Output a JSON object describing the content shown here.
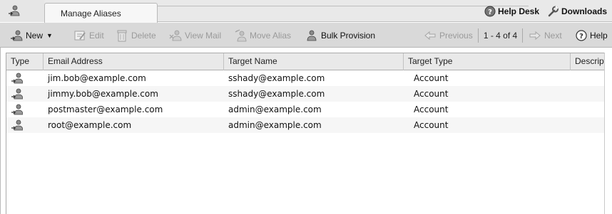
{
  "tab": {
    "label": "Manage Aliases"
  },
  "top_links": {
    "help_desk": "Help Desk",
    "downloads": "Downloads"
  },
  "toolbar": {
    "new": "New",
    "edit": "Edit",
    "delete": "Delete",
    "view_mail": "View Mail",
    "move_alias": "Move Alias",
    "bulk_provision": "Bulk Provision",
    "previous": "Previous",
    "page_info": "1 - 4 of 4",
    "next": "Next",
    "help": "Help"
  },
  "table": {
    "headers": [
      "Type",
      "Email Address",
      "Target Name",
      "Target Type",
      "Descripti"
    ],
    "rows": [
      {
        "email": "jim.bob@example.com",
        "target_name": "sshady@example.com",
        "target_type": "Account"
      },
      {
        "email": "jimmy.bob@example.com",
        "target_name": "sshady@example.com",
        "target_type": "Account"
      },
      {
        "email": "postmaster@example.com",
        "target_name": "admin@example.com",
        "target_type": "Account"
      },
      {
        "email": "root@example.com",
        "target_name": "admin@example.com",
        "target_type": "Account"
      }
    ]
  },
  "icons": {
    "app": "user-alias-icon",
    "new": "user-alias-icon",
    "edit": "edit-icon",
    "delete": "trash-icon",
    "view_mail": "view-mail-icon",
    "move_alias": "move-alias-icon",
    "bulk_provision": "bulk-provision-icon",
    "previous": "arrow-left-icon",
    "next": "arrow-right-icon",
    "help": "help-icon",
    "downloads": "wrench-icon",
    "row_type": "user-alias-icon"
  }
}
